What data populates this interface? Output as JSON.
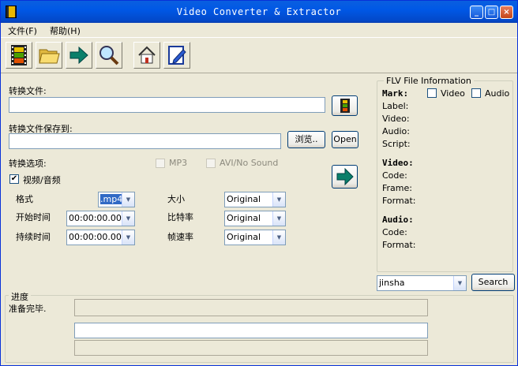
{
  "window": {
    "title": "Video Converter & Extractor",
    "minimize": "_",
    "maximize": "□",
    "close": "×"
  },
  "menu": [
    "文件(F)",
    "帮助(H)"
  ],
  "toolbar": {
    "icons": [
      "film-icon",
      "folder-open-icon",
      "arrow-right-icon",
      "magnifier-icon",
      "home-icon",
      "edit-notepad-icon"
    ]
  },
  "main": {
    "convert_file_label": "转换文件:",
    "convert_file_value": "",
    "save_to_label": "转换文件保存到:",
    "save_to_value": "",
    "browse_label": "浏览..",
    "open_label": "Open",
    "options_label": "转换选项:",
    "mp3_label": "MP3",
    "avi_label": "AVI/No Sound",
    "video_audio_label": "视频/音频",
    "video_audio_checked": "✔",
    "format_label": "格式",
    "format_value": ".mp4",
    "size_label": "大小",
    "size_value": "Original",
    "start_label": "开始时间",
    "start_value": "00:00:00.00",
    "bitrate_label": "比特率",
    "bitrate_value": "Original",
    "duration_label": "持续时间",
    "duration_value": "00:00:00.00",
    "framerate_label": "帧速率",
    "framerate_value": "Original"
  },
  "info": {
    "title": "FLV File Information",
    "mark_label": "Mark:",
    "video_check_label": "Video",
    "audio_check_label": "Audio",
    "label_label": "Label:",
    "video_label": "Video:",
    "audio_label": "Audio:",
    "script_label": "Script:",
    "video_section": "Video:",
    "code_label": "Code:",
    "frame_label": "Frame:",
    "format_label": "Format:",
    "audio_section": "Audio:",
    "audio_code_label": "Code:",
    "audio_format_label": "Format:"
  },
  "search": {
    "value": "jinsha",
    "button": "Search"
  },
  "progress": {
    "title": "进度",
    "status": "准备完毕.",
    "percent": 0
  }
}
